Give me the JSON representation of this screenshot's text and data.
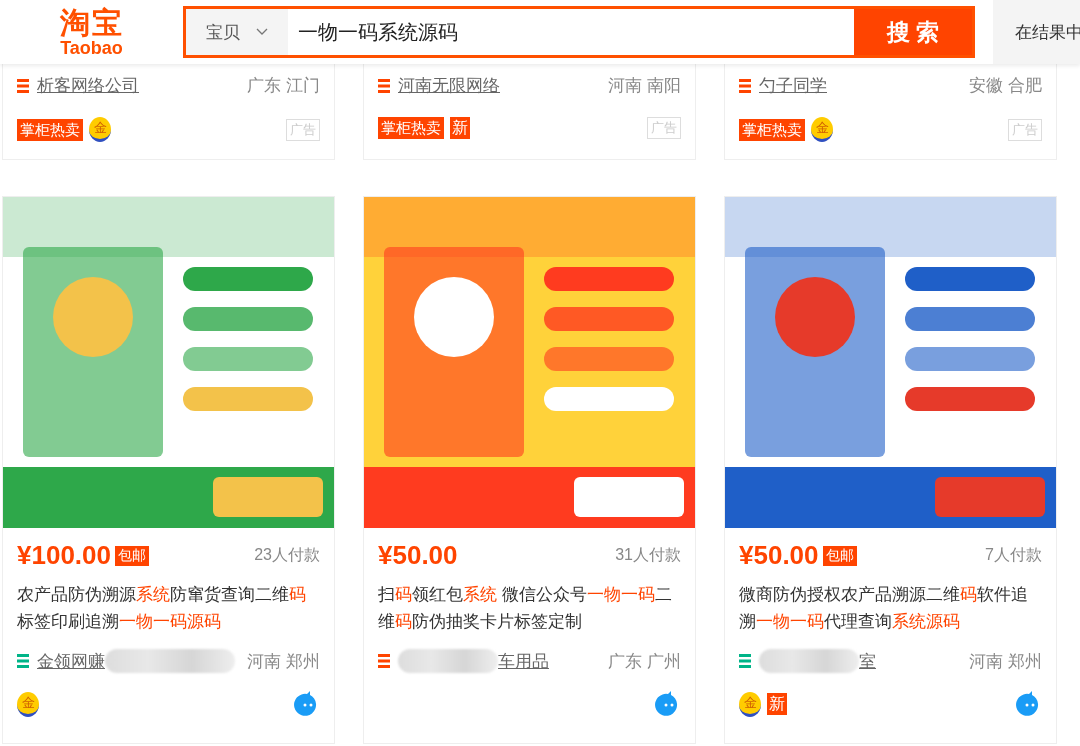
{
  "header": {
    "logo_cn": "淘宝",
    "logo_en": "Taobao",
    "search": {
      "category": "宝贝",
      "value": "一物一码系统源码",
      "button": "搜 索"
    },
    "side_button": "在结果中"
  },
  "top_cards": [
    {
      "shop": "析客网络公司",
      "color": "#ff4400",
      "location": "广东 江门",
      "tags": [
        {
          "kind": "hot",
          "text": "掌柜热卖"
        },
        {
          "kind": "gold",
          "text": "金"
        }
      ],
      "ad": "广告"
    },
    {
      "shop": "河南无限网络",
      "color": "#ff4400",
      "location": "河南 南阳",
      "tags": [
        {
          "kind": "hot",
          "text": "掌柜热卖"
        },
        {
          "kind": "new",
          "text": "新"
        }
      ],
      "ad": "广告"
    },
    {
      "shop": "勺子同学",
      "color": "#ff4400",
      "location": "安徽 合肥",
      "tags": [
        {
          "kind": "hot",
          "text": "掌柜热卖"
        },
        {
          "kind": "gold",
          "text": "金"
        }
      ],
      "ad": "广告"
    }
  ],
  "cards": [
    {
      "image": {
        "kind": "picture"
      },
      "price": "¥100.00",
      "shipping": "包邮",
      "sales": "23人付款",
      "title": [
        {
          "text": "农产品防伪溯源",
          "highlight": false
        },
        {
          "text": "系统",
          "highlight": true
        },
        {
          "text": "防窜货查询二维",
          "highlight": false
        },
        {
          "text": "码",
          "highlight": true
        },
        {
          "text": "标签印刷追溯",
          "highlight": false
        },
        {
          "text": "一物一码源码",
          "highlight": true
        }
      ],
      "color": "#00b488",
      "shop_parts": [
        {
          "kind": "text",
          "text": "金领网赚"
        },
        {
          "kind": "blur"
        }
      ],
      "location": "河南 郑州",
      "tags": [
        {
          "kind": "gold",
          "text": "金"
        }
      ],
      "chat": true
    },
    {
      "image": {
        "kind": "picture"
      },
      "price": "¥50.00",
      "sales": "31人付款",
      "title": [
        {
          "text": "扫",
          "highlight": false
        },
        {
          "text": "码",
          "highlight": true
        },
        {
          "text": "领红包",
          "highlight": false
        },
        {
          "text": "系统",
          "highlight": true
        },
        {
          "text": " 微信公众号",
          "highlight": false
        },
        {
          "text": "一物一码",
          "highlight": true
        },
        {
          "text": "二维",
          "highlight": false
        },
        {
          "text": "码",
          "highlight": true
        },
        {
          "text": "防伪抽奖卡片标签定制",
          "highlight": false
        }
      ],
      "color": "#ff4400",
      "shop_parts": [
        {
          "kind": "blur"
        },
        {
          "kind": "text",
          "text": "车用品"
        }
      ],
      "location": "广东 广州",
      "chat": true
    },
    {
      "image": {
        "kind": "picture"
      },
      "price": "¥50.00",
      "shipping": "包邮",
      "sales": "7人付款",
      "title": [
        {
          "text": "微商防伪授权农产品溯源二维",
          "highlight": false
        },
        {
          "text": "码",
          "highlight": true
        },
        {
          "text": "软件追溯",
          "highlight": false
        },
        {
          "text": "一物一码",
          "highlight": true
        },
        {
          "text": "代理查询",
          "highlight": false
        },
        {
          "text": "系统源码",
          "highlight": true
        }
      ],
      "color": "#00b488",
      "shop_parts": [
        {
          "kind": "blur"
        },
        {
          "kind": "text",
          "text": "室"
        }
      ],
      "location": "河南 郑州",
      "tags": [
        {
          "kind": "gold",
          "text": "金"
        },
        {
          "kind": "new",
          "text": "新"
        }
      ],
      "chat": true
    }
  ]
}
